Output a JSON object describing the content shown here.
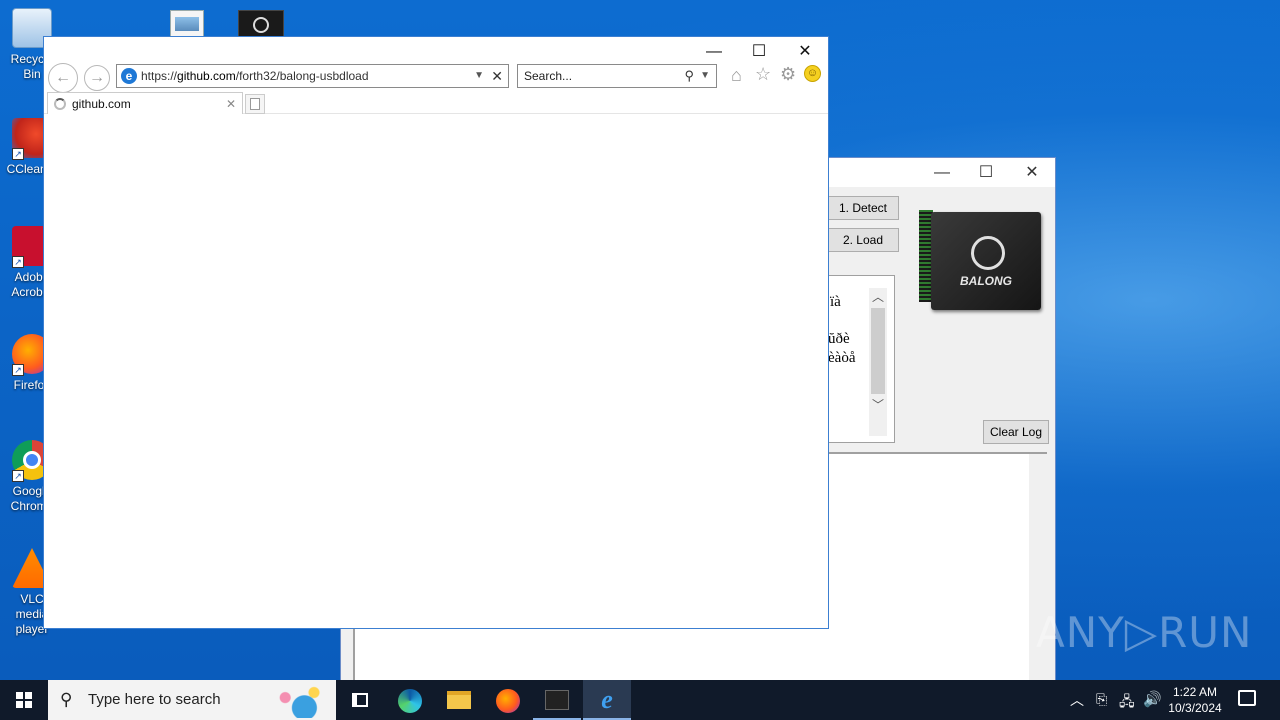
{
  "desktop": {
    "icons": [
      {
        "label": "Recycle Bin"
      },
      {
        "label": "CCleaner"
      },
      {
        "label": "Adobe Acrobat"
      },
      {
        "label": "Firefox"
      },
      {
        "label": "Google Chrome"
      },
      {
        "label": "VLC media player"
      }
    ]
  },
  "balong_window": {
    "detect_label": "1. Detect",
    "load_label": "2. Load",
    "clear_log_label": "Clear Log",
    "log_lines": [
      "ïà",
      "ŭðè",
      "èàòå"
    ],
    "chip_brand": "BALONG",
    "min_icon": "—",
    "max_icon": "☐",
    "close_icon": "✕"
  },
  "ie": {
    "url_prefix": "https://",
    "url_domain": "github.com",
    "url_path": "/forth32/balong-usbdload",
    "search_placeholder": "Search...",
    "tab_title": "github.com",
    "min_icon": "—",
    "max_icon": "☐",
    "close_icon": "✕"
  },
  "taskbar": {
    "search_placeholder": "Type here to search",
    "time": "1:22 AM",
    "date": "10/3/2024"
  },
  "watermark": "ANY▷RUN"
}
